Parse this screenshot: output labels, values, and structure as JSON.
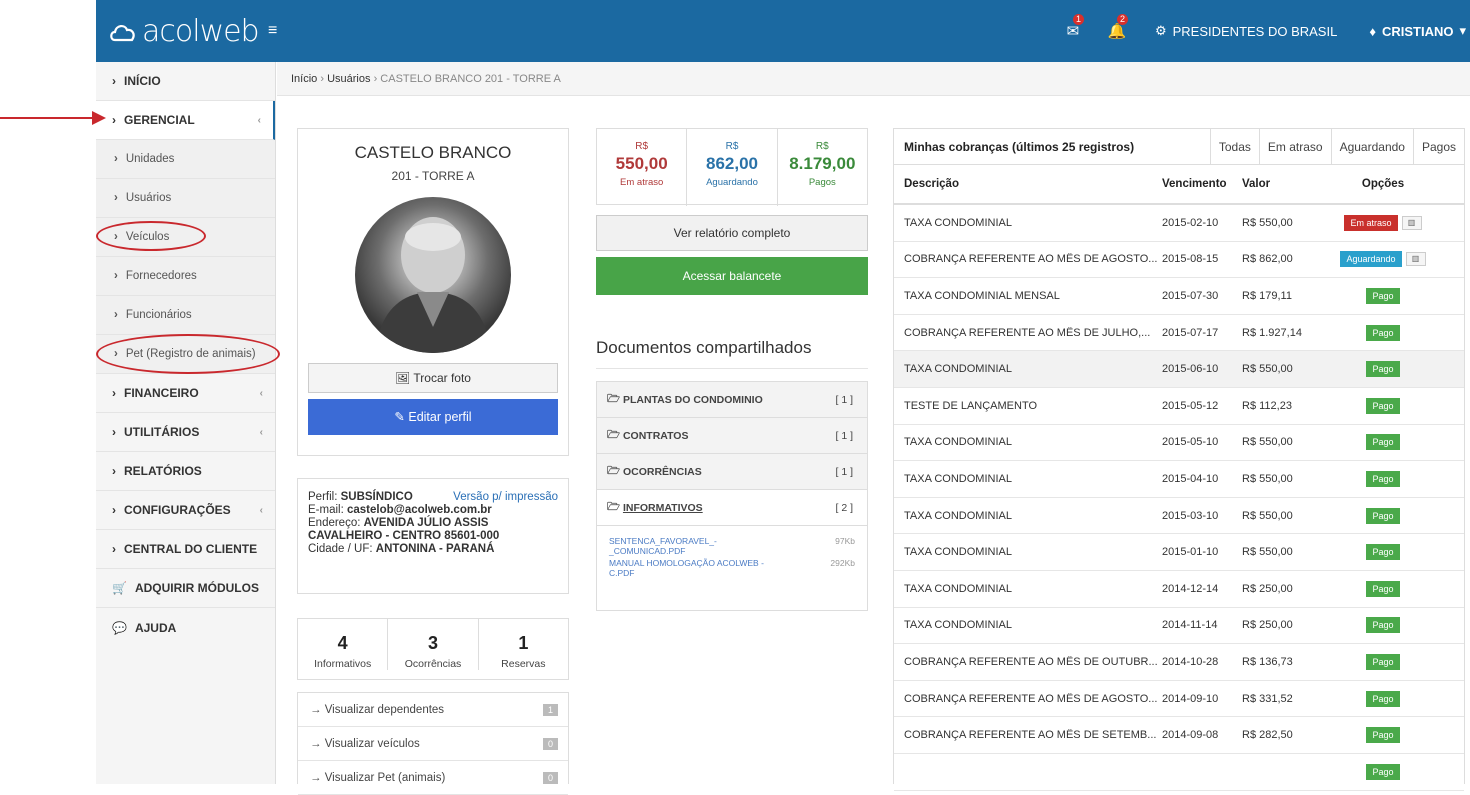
{
  "app": {
    "logo": "acolweb",
    "condo": "PRESIDENTES DO BRASIL",
    "user": "CRISTIANO",
    "mail_count": "1",
    "bell_count": "2"
  },
  "sidebar": {
    "items": [
      {
        "label": "INÍCIO"
      },
      {
        "label": "GERENCIAL"
      },
      {
        "label": "Unidades"
      },
      {
        "label": "Usuários"
      },
      {
        "label": "Veículos"
      },
      {
        "label": "Fornecedores"
      },
      {
        "label": "Funcionários"
      },
      {
        "label": "Pet (Registro de animais)"
      },
      {
        "label": "FINANCEIRO"
      },
      {
        "label": "UTILITÁRIOS"
      },
      {
        "label": "RELATÓRIOS"
      },
      {
        "label": "CONFIGURAÇÕES"
      },
      {
        "label": "CENTRAL DO CLIENTE"
      },
      {
        "label": "ADQUIRIR MÓDULOS"
      },
      {
        "label": "AJUDA"
      }
    ]
  },
  "breadcrumb": {
    "home": "Início",
    "users": "Usuários",
    "current": "CASTELO BRANCO 201 - TORRE A"
  },
  "profile": {
    "name": "CASTELO BRANCO",
    "unit": "201 - TORRE A",
    "change_photo": "Trocar foto",
    "edit_profile": "Editar perfil",
    "perfil_label": "Perfil:",
    "perfil": "SUBSÍNDICO",
    "print": "Versão p/ impressão",
    "email_label": "E-mail:",
    "email": "castelob@acolweb.com.br",
    "addr_label": "Endereço:",
    "addr": "AVENIDA JÚLIO ASSIS CAVALHEIRO - CENTRO 85601-000",
    "city_label": "Cidade / UF:",
    "city": "ANTONINA - PARANÁ"
  },
  "stats": [
    {
      "n": "4",
      "l": "Informativos"
    },
    {
      "n": "3",
      "l": "Ocorrências"
    },
    {
      "n": "1",
      "l": "Reservas"
    }
  ],
  "links": [
    {
      "label": "Visualizar dependentes",
      "count": "1"
    },
    {
      "label": "Visualizar veículos",
      "count": "0"
    },
    {
      "label": "Visualizar Pet (animais)",
      "count": "0"
    }
  ],
  "money": [
    {
      "c": "R$",
      "v": "550,00",
      "l": "Em atraso",
      "color": "#b03a3a"
    },
    {
      "c": "R$",
      "v": "862,00",
      "l": "Aguardando",
      "color": "#2a72a8"
    },
    {
      "c": "R$",
      "v": "8.179,00",
      "l": "Pagos",
      "color": "#3a8a3a"
    }
  ],
  "buttons": {
    "report": "Ver relatório completo",
    "balance": "Acessar balancete"
  },
  "docs": {
    "title": "Documentos compartilhados",
    "folders": [
      {
        "name": "PLANTAS DO CONDOMINIO",
        "count": "[ 1 ]"
      },
      {
        "name": "CONTRATOS",
        "count": "[ 1 ]"
      },
      {
        "name": "OCORRÊNCIAS",
        "count": "[ 1 ]"
      },
      {
        "name": "INFORMATIVOS",
        "count": "[ 2 ]"
      }
    ],
    "files": [
      {
        "name": "SENTENCA_FAVORAVEL_-_COMUNICAD.PDF",
        "size": "97Kb"
      },
      {
        "name": "MANUAL HOMOLOGAÇÃO ACOLWEB - C.PDF",
        "size": "292Kb"
      }
    ]
  },
  "billing": {
    "title": "Minhas cobranças (últimos 25 registros)",
    "tabs": [
      "Todas",
      "Em atraso",
      "Aguardando",
      "Pagos"
    ],
    "headers": [
      "Descrição",
      "Vencimento",
      "Valor",
      "Opções"
    ],
    "rows": [
      {
        "d": "TAXA CONDOMINIAL",
        "v": "2015-02-10",
        "val": "R$ 550,00",
        "s": "Em atraso",
        "t": "late"
      },
      {
        "d": "COBRANÇA REFERENTE AO MÊS DE AGOSTO...",
        "v": "2015-08-15",
        "val": "R$ 862,00",
        "s": "Aguardando",
        "t": "wait"
      },
      {
        "d": "TAXA CONDOMINIAL MENSAL",
        "v": "2015-07-30",
        "val": "R$ 179,11",
        "s": "Pago",
        "t": "paid"
      },
      {
        "d": "COBRANÇA REFERENTE AO MÊS DE JULHO,...",
        "v": "2015-07-17",
        "val": "R$ 1.927,14",
        "s": "Pago",
        "t": "paid"
      },
      {
        "d": "TAXA CONDOMINIAL",
        "v": "2015-06-10",
        "val": "R$ 550,00",
        "s": "Pago",
        "t": "paid"
      },
      {
        "d": "TESTE DE LANÇAMENTO",
        "v": "2015-05-12",
        "val": "R$ 112,23",
        "s": "Pago",
        "t": "paid"
      },
      {
        "d": "TAXA CONDOMINIAL",
        "v": "2015-05-10",
        "val": "R$ 550,00",
        "s": "Pago",
        "t": "paid"
      },
      {
        "d": "TAXA CONDOMINIAL",
        "v": "2015-04-10",
        "val": "R$ 550,00",
        "s": "Pago",
        "t": "paid"
      },
      {
        "d": "TAXA CONDOMINIAL",
        "v": "2015-03-10",
        "val": "R$ 550,00",
        "s": "Pago",
        "t": "paid"
      },
      {
        "d": "TAXA CONDOMINIAL",
        "v": "2015-01-10",
        "val": "R$ 550,00",
        "s": "Pago",
        "t": "paid"
      },
      {
        "d": "TAXA CONDOMINIAL",
        "v": "2014-12-14",
        "val": "R$ 250,00",
        "s": "Pago",
        "t": "paid"
      },
      {
        "d": "TAXA CONDOMINIAL",
        "v": "2014-11-14",
        "val": "R$ 250,00",
        "s": "Pago",
        "t": "paid"
      },
      {
        "d": "COBRANÇA REFERENTE AO MÊS DE OUTUBR...",
        "v": "2014-10-28",
        "val": "R$ 136,73",
        "s": "Pago",
        "t": "paid"
      },
      {
        "d": "COBRANÇA REFERENTE AO MÊS DE AGOSTO...",
        "v": "2014-09-10",
        "val": "R$ 331,52",
        "s": "Pago",
        "t": "paid"
      },
      {
        "d": "COBRANÇA REFERENTE AO MÊS DE SETEMB...",
        "v": "2014-09-08",
        "val": "R$ 282,50",
        "s": "Pago",
        "t": "paid"
      },
      {
        "d": "",
        "v": "",
        "val": "",
        "s": "Pago",
        "t": "paid"
      }
    ]
  }
}
